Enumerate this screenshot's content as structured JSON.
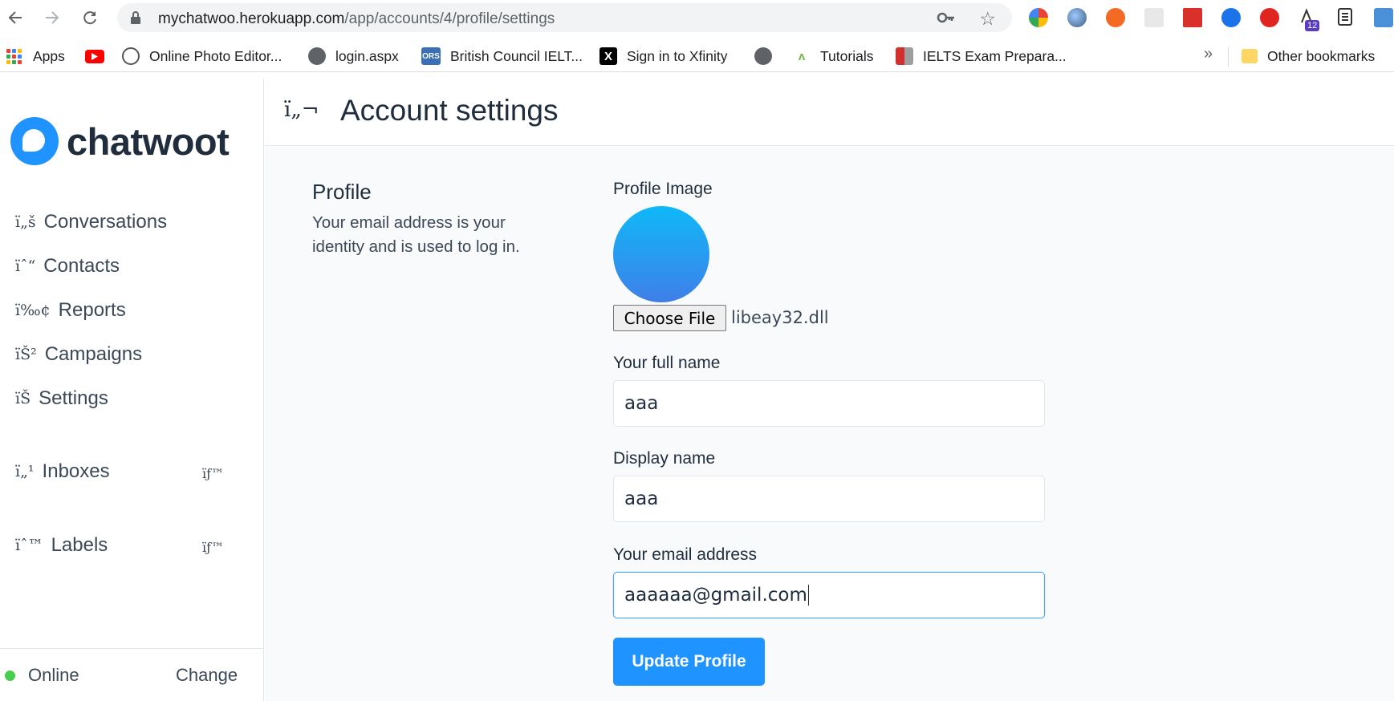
{
  "browser": {
    "url_host": "mychatwoo.herokuapp.com",
    "url_path": "/app/accounts/4/profile/settings",
    "extension_badge": "12"
  },
  "bookmarks": [
    {
      "label": "Apps",
      "icon": "apps-grid-icon"
    },
    {
      "label": "",
      "icon": "youtube-icon"
    },
    {
      "label": "Online Photo Editor...",
      "icon": "photo-editor-icon"
    },
    {
      "label": "login.aspx",
      "icon": "globe-icon"
    },
    {
      "label": "British Council IELT...",
      "icon": "ors-icon"
    },
    {
      "label": "Sign in to Xfinity",
      "icon": "x-icon"
    },
    {
      "label": "",
      "icon": "globe-icon"
    },
    {
      "label": "Tutorials",
      "icon": "tutorials-icon"
    },
    {
      "label": "IELTS Exam Prepara...",
      "icon": "ielts-icon"
    }
  ],
  "bookmarks_more": "»",
  "other_bookmarks": "Other bookmarks",
  "app": {
    "brand": "chatwoot",
    "sidebar": {
      "items": [
        {
          "glyph": "ï„š",
          "label": "Conversations"
        },
        {
          "glyph": "ïˆ“",
          "label": "Contacts"
        },
        {
          "glyph": "ï‰¢",
          "label": "Reports"
        },
        {
          "glyph": "ïŠ²",
          "label": "Campaigns"
        },
        {
          "glyph": "ïŠ",
          "label": "Settings"
        }
      ],
      "inboxes": {
        "glyph": "ï„¹",
        "label": "Inboxes",
        "side_glyph": "ïƒ™"
      },
      "labels": {
        "glyph": "ïˆ™",
        "label": "Labels",
        "side_glyph": "ïƒ™"
      },
      "status": "Online",
      "change": "Change"
    },
    "header": {
      "glyph": "ï„¬",
      "title": "Account settings"
    },
    "profile": {
      "title": "Profile",
      "description": "Your email address is your identity and is used to log in.",
      "image_label": "Profile Image",
      "choose_file": "Choose File",
      "file_name": "libeay32.dll",
      "full_name_label": "Your full name",
      "full_name": "aaa",
      "display_name_label": "Display name",
      "display_name": "aaa",
      "email_label": "Your email address",
      "email": "aaaaaa@gmail.com",
      "update_button": "Update Profile"
    }
  },
  "colors": {
    "brand": "#1f93ff",
    "online": "#44ce4b",
    "avatar_top": "#0fb9f8",
    "avatar_bottom": "#3f7fe8"
  }
}
